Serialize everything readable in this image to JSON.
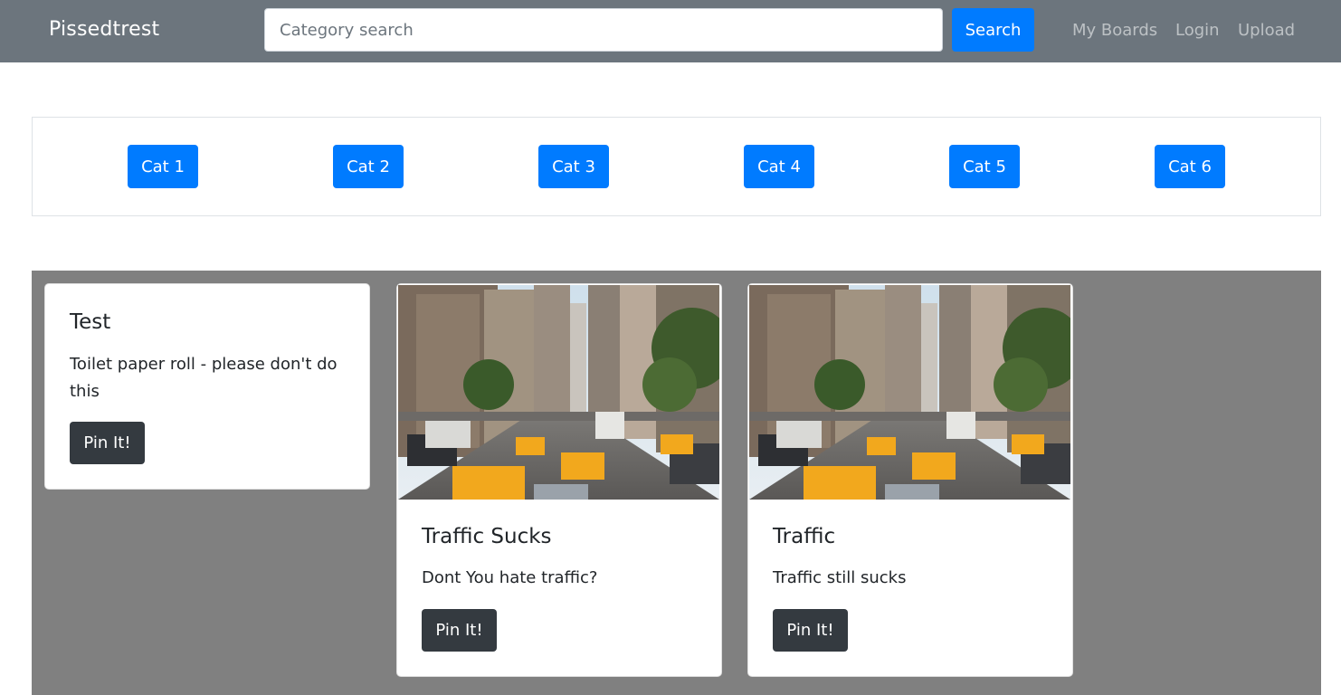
{
  "navbar": {
    "brand": "Pissedtrest",
    "search_placeholder": "Category search",
    "search_button": "Search",
    "links": [
      "My Boards",
      "Login",
      "Upload"
    ]
  },
  "categories": [
    "Cat 1",
    "Cat 2",
    "Cat 3",
    "Cat 4",
    "Cat 5",
    "Cat 6"
  ],
  "cards": [
    {
      "title": "Test",
      "text": "Toilet paper roll - please don't do this",
      "button": "Pin It!"
    },
    {
      "title": "Traffic Sucks",
      "text": "Dont You hate traffic?",
      "button": "Pin It!",
      "image": "city-traffic-photo"
    },
    {
      "title": "Traffic",
      "text": "Traffic still sucks",
      "button": "Pin It!",
      "image": "city-traffic-photo"
    }
  ],
  "colors": {
    "navbar": "#6c757d",
    "primary": "#007bff",
    "dark": "#343a40",
    "grid_background": "#808080"
  }
}
